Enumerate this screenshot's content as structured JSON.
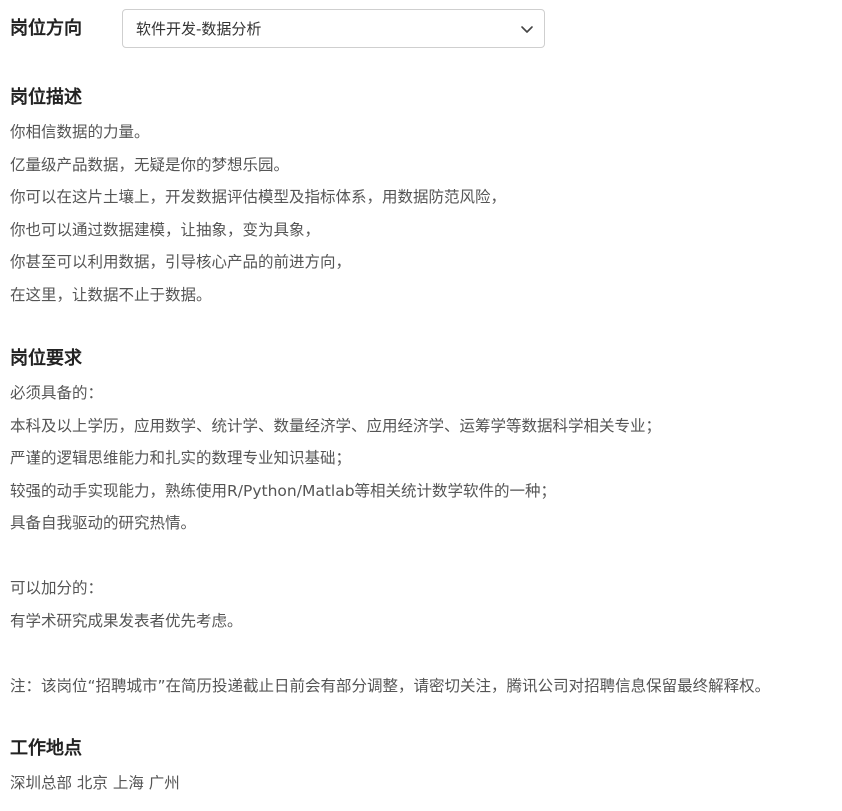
{
  "position_direction": {
    "label": "岗位方向",
    "selected": "软件开发-数据分析"
  },
  "description": {
    "heading": "岗位描述",
    "lines": [
      "你相信数据的力量。",
      "亿量级产品数据，无疑是你的梦想乐园。",
      "你可以在这片土壤上，开发数据评估模型及指标体系，用数据防范风险，",
      "你也可以通过数据建模，让抽象，变为具象，",
      "你甚至可以利用数据，引导核心产品的前进方向，",
      "在这里，让数据不止于数据。"
    ]
  },
  "requirements": {
    "heading": "岗位要求",
    "required_title": "必须具备的：",
    "required_items": [
      "本科及以上学历，应用数学、统计学、数量经济学、应用经济学、运筹学等数据科学相关专业；",
      "严谨的逻辑思维能力和扎实的数理专业知识基础；",
      "较强的动手实现能力，熟练使用R/Python/Matlab等相关统计数学软件的一种；",
      "具备自我驱动的研究热情。"
    ],
    "bonus_title": "可以加分的：",
    "bonus_items": [
      "有学术研究成果发表者优先考虑。"
    ],
    "note": "注：该岗位“招聘城市”在简历投递截止日前会有部分调整，请密切关注，腾讯公司对招聘信息保留最终解释权。"
  },
  "location": {
    "heading": "工作地点",
    "value": "深圳总部 北京 上海 广州"
  },
  "icons": {
    "dropdown": "chevron-down-icon"
  },
  "colors": {
    "heading": "#222222",
    "body_text": "#555555",
    "select_border": "#cfcfcf"
  }
}
